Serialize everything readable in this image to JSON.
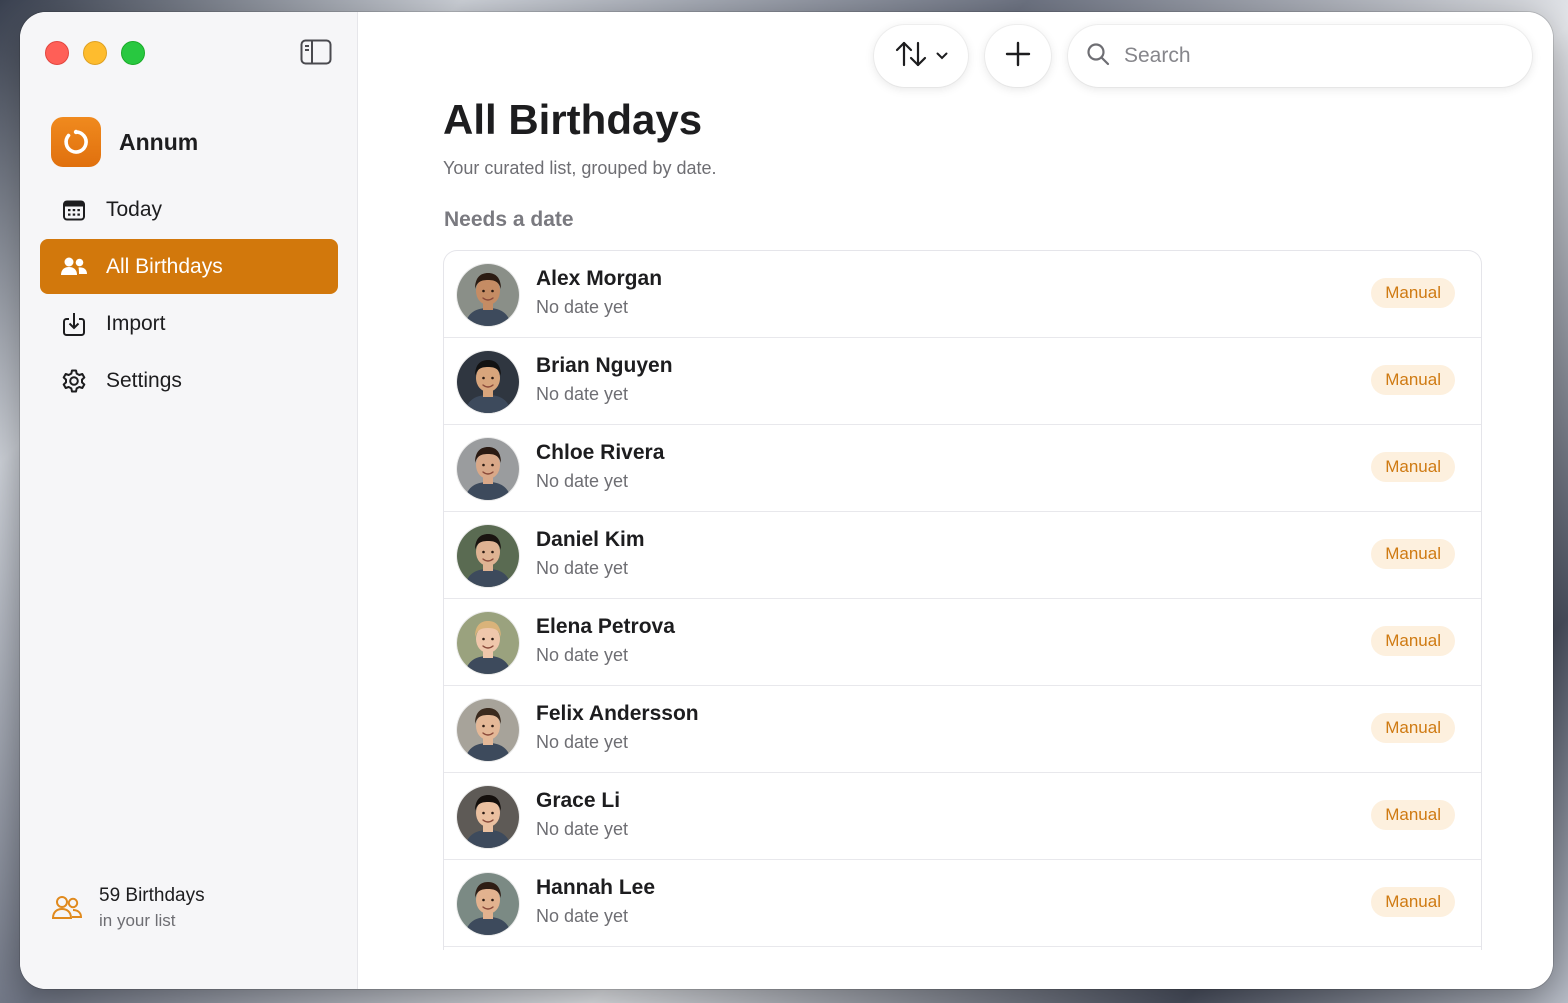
{
  "colors": {
    "accent": "#d2780c",
    "badge_bg": "#fdf0de",
    "badge_text": "#cf7a12",
    "traffic_red": "#ff5f57",
    "traffic_yellow": "#febc2e",
    "traffic_green": "#28c840"
  },
  "sidebar": {
    "app_name": "Annum",
    "items": [
      {
        "label": "Today",
        "icon": "calendar-icon",
        "active": false
      },
      {
        "label": "All Birthdays",
        "icon": "people-icon",
        "active": true
      },
      {
        "label": "Import",
        "icon": "import-icon",
        "active": false
      },
      {
        "label": "Settings",
        "icon": "gear-icon",
        "active": false
      }
    ],
    "footer": {
      "count_label": "59 Birthdays",
      "sub_label": "in your list",
      "icon": "people-outline-icon"
    }
  },
  "toolbar": {
    "sort_icon": "sort-arrows-icon",
    "add_icon": "plus-icon",
    "search_placeholder": "Search"
  },
  "main": {
    "title": "All Birthdays",
    "subtitle": "Your curated list, grouped by date.",
    "section_title": "Needs a date",
    "people": [
      {
        "name": "Alex Morgan",
        "status": "No date yet",
        "badge": "Manual",
        "skin": "#c58c64",
        "hair": "#2b1b12",
        "bg": "#8a8f88"
      },
      {
        "name": "Brian Nguyen",
        "status": "No date yet",
        "badge": "Manual",
        "skin": "#d8a57c",
        "hair": "#121212",
        "bg": "#2f3640"
      },
      {
        "name": "Chloe Rivera",
        "status": "No date yet",
        "badge": "Manual",
        "skin": "#d9a888",
        "hair": "#2a1a12",
        "bg": "#9a9c9e"
      },
      {
        "name": "Daniel Kim",
        "status": "No date yet",
        "badge": "Manual",
        "skin": "#dfb393",
        "hair": "#1a1410",
        "bg": "#5a6b52"
      },
      {
        "name": "Elena Petrova",
        "status": "No date yet",
        "badge": "Manual",
        "skin": "#efc7ab",
        "hair": "#d9b37a",
        "bg": "#9aa27e"
      },
      {
        "name": "Felix Andersson",
        "status": "No date yet",
        "badge": "Manual",
        "skin": "#e4b897",
        "hair": "#3a2a1e",
        "bg": "#a7a39a"
      },
      {
        "name": "Grace Li",
        "status": "No date yet",
        "badge": "Manual",
        "skin": "#eac0a0",
        "hair": "#140f0c",
        "bg": "#5e5a56"
      },
      {
        "name": "Hannah Lee",
        "status": "No date yet",
        "badge": "Manual",
        "skin": "#e2b28f",
        "hair": "#2e1d14",
        "bg": "#7b8a84"
      }
    ]
  }
}
